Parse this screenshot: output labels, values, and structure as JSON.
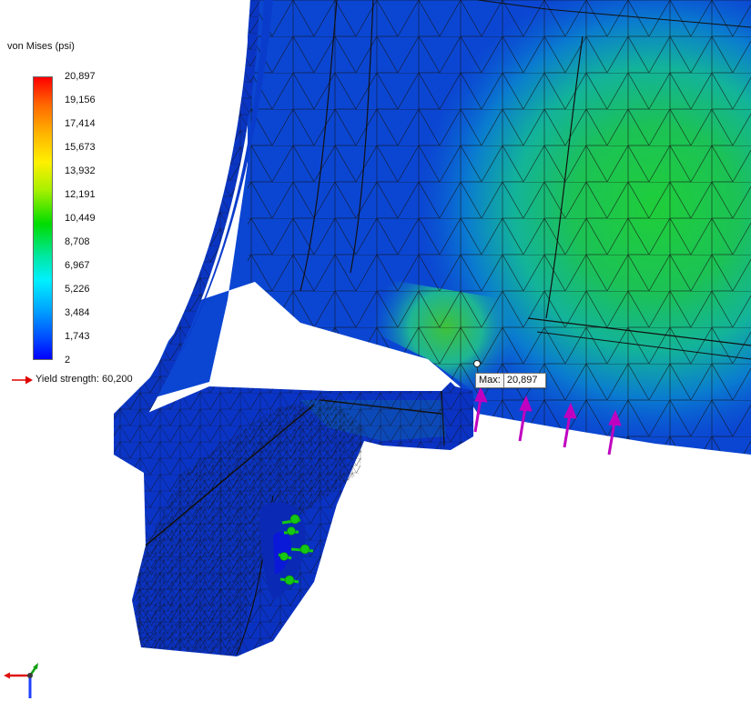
{
  "legend": {
    "title": "von Mises (psi)",
    "ticks": [
      "20,897",
      "19,156",
      "17,414",
      "15,673",
      "13,932",
      "12,191",
      "10,449",
      "8,708",
      "6,967",
      "5,226",
      "3,484",
      "1,743",
      "2"
    ],
    "yield_label": "Yield strength: 60,200"
  },
  "probe": {
    "label": "Max:",
    "value": "20,897"
  },
  "colors": {
    "mesh_line": "#111111",
    "load_arrow": "#c000c0",
    "fixture": "#14c814",
    "yield_arrow": "#e00000"
  },
  "icons": {
    "load": "magenta-force-arrow",
    "fixture": "green-fixture-arrow",
    "axes": "coordinate-triad"
  }
}
